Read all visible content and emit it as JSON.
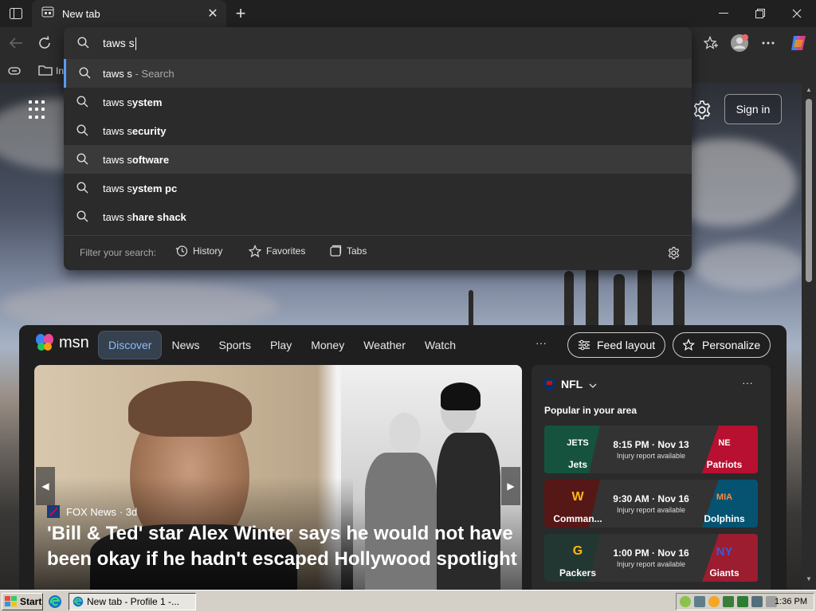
{
  "tab": {
    "title": "New tab"
  },
  "omnibox": {
    "typed": "taws s",
    "suggestions": [
      {
        "prefix": "taws s",
        "bold": "",
        "hint": " - Search"
      },
      {
        "prefix": "taws s",
        "bold": "ystem",
        "hint": ""
      },
      {
        "prefix": "taws s",
        "bold": "ecurity",
        "hint": ""
      },
      {
        "prefix": "taws s",
        "bold": "oftware",
        "hint": ""
      },
      {
        "prefix": "taws s",
        "bold": "ystem pc",
        "hint": ""
      },
      {
        "prefix": "taws s",
        "bold": "hare shack",
        "hint": ""
      }
    ],
    "filter_label": "Filter your search:",
    "filters": [
      "History",
      "Favorites",
      "Tabs"
    ]
  },
  "favbar": {
    "item_fragment": "In"
  },
  "page": {
    "sign_in": "Sign in"
  },
  "msn": {
    "logo": "msn",
    "nav": [
      "Discover",
      "News",
      "Sports",
      "Play",
      "Money",
      "Weather",
      "Watch"
    ],
    "more": "···",
    "feed_layout": "Feed layout",
    "personalize": "Personalize",
    "hero": {
      "source": "FOX News",
      "age": "· 3d",
      "title": "'Bill & Ted' star Alex Winter says he would not have been okay if he hadn't escaped Hollywood spotlight"
    },
    "nfl": {
      "league": "NFL",
      "subtitle": "Popular in your area",
      "more": "···",
      "games": [
        {
          "home": "Jets",
          "away": "Patriots",
          "time": "8:15 PM · Nov 13",
          "note": "Injury report available",
          "home_color": "#125740",
          "away_color": "#c60c30",
          "home_logo": "JETS",
          "away_logo": "NE"
        },
        {
          "home": "Comman...",
          "away": "Dolphins",
          "time": "9:30 AM · Nov 16",
          "note": "Injury report available",
          "home_color": "#5a1414",
          "away_color": "#005778",
          "home_logo": "W",
          "away_logo": "MIA"
        },
        {
          "home": "Packers",
          "away": "Giants",
          "time": "1:00 PM · Nov 16",
          "note": "Injury report available",
          "home_color": "#203731",
          "away_color": "#a71930",
          "home_logo": "G",
          "away_logo": "NY"
        }
      ]
    }
  },
  "taskbar": {
    "start": "Start",
    "task": "New tab - Profile 1 -...",
    "clock": "1:36 PM"
  }
}
